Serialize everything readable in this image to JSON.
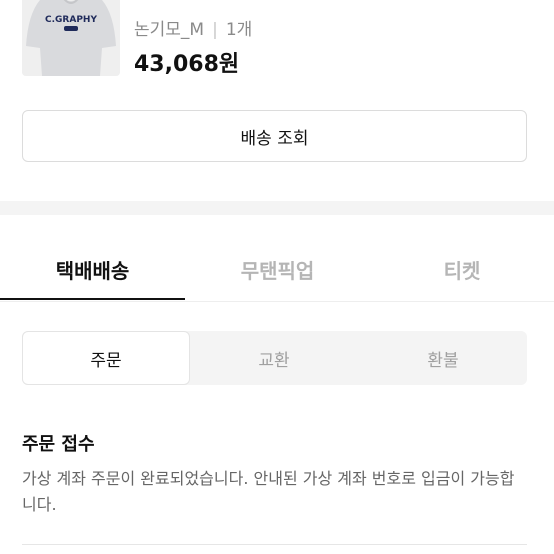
{
  "product": {
    "name_visible_partial": "",
    "option": "논기모_M",
    "quantity": "1개",
    "price": "43,068원",
    "image_brand_text": "C.GRAPHY",
    "image_label_icon": "hoodie-image"
  },
  "actions": {
    "track_delivery_label": "배송 조회"
  },
  "tabs": [
    {
      "label": "택배배송",
      "active": true
    },
    {
      "label": "무탠픽업",
      "active": false
    },
    {
      "label": "티켓",
      "active": false
    }
  ],
  "segments": [
    {
      "label": "주문",
      "active": true
    },
    {
      "label": "교환",
      "active": false
    },
    {
      "label": "환불",
      "active": false
    }
  ],
  "status": {
    "title": "주문 접수",
    "description": "가상 계좌 주문이 완료되었습니다. 안내된 가상 계좌 번호로 입금이 가능합니다."
  },
  "colors": {
    "text_primary": "#111111",
    "text_muted": "#8a8a8a",
    "tab_inactive": "#b5b5b5",
    "divider": "#f4f4f4"
  }
}
